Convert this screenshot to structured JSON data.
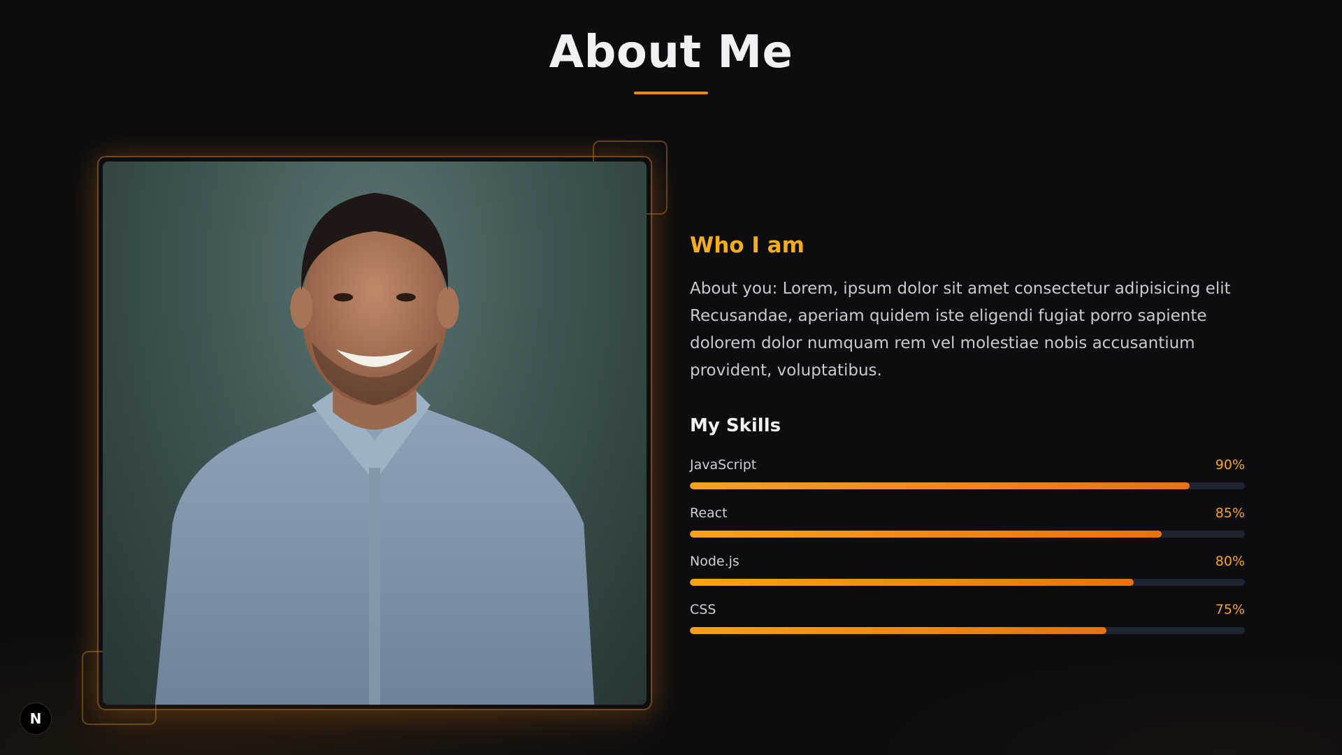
{
  "header": {
    "title": "About Me"
  },
  "about": {
    "who_heading": "Who I am",
    "text": "About you: Lorem, ipsum dolor sit amet consectetur adipisicing elit Recusandae, aperiam quidem iste eligendi fugiat porro sapiente dolorem dolor numquam rem vel molestiae nobis accusantium provident, voluptatibus."
  },
  "skills": {
    "heading": "My Skills",
    "items": [
      {
        "name": "JavaScript",
        "percent_label": "90%",
        "percent": 90
      },
      {
        "name": "React",
        "percent_label": "85%",
        "percent": 85
      },
      {
        "name": "Node.js",
        "percent_label": "80%",
        "percent": 80
      },
      {
        "name": "CSS",
        "percent_label": "75%",
        "percent": 75
      }
    ]
  },
  "badge": {
    "label": "N"
  },
  "colors": {
    "accent": "#f5ad1b",
    "bar_start": "#f7a21a",
    "bar_end": "#e8720d",
    "background": "#0d0d0f",
    "track": "#1f2530"
  }
}
